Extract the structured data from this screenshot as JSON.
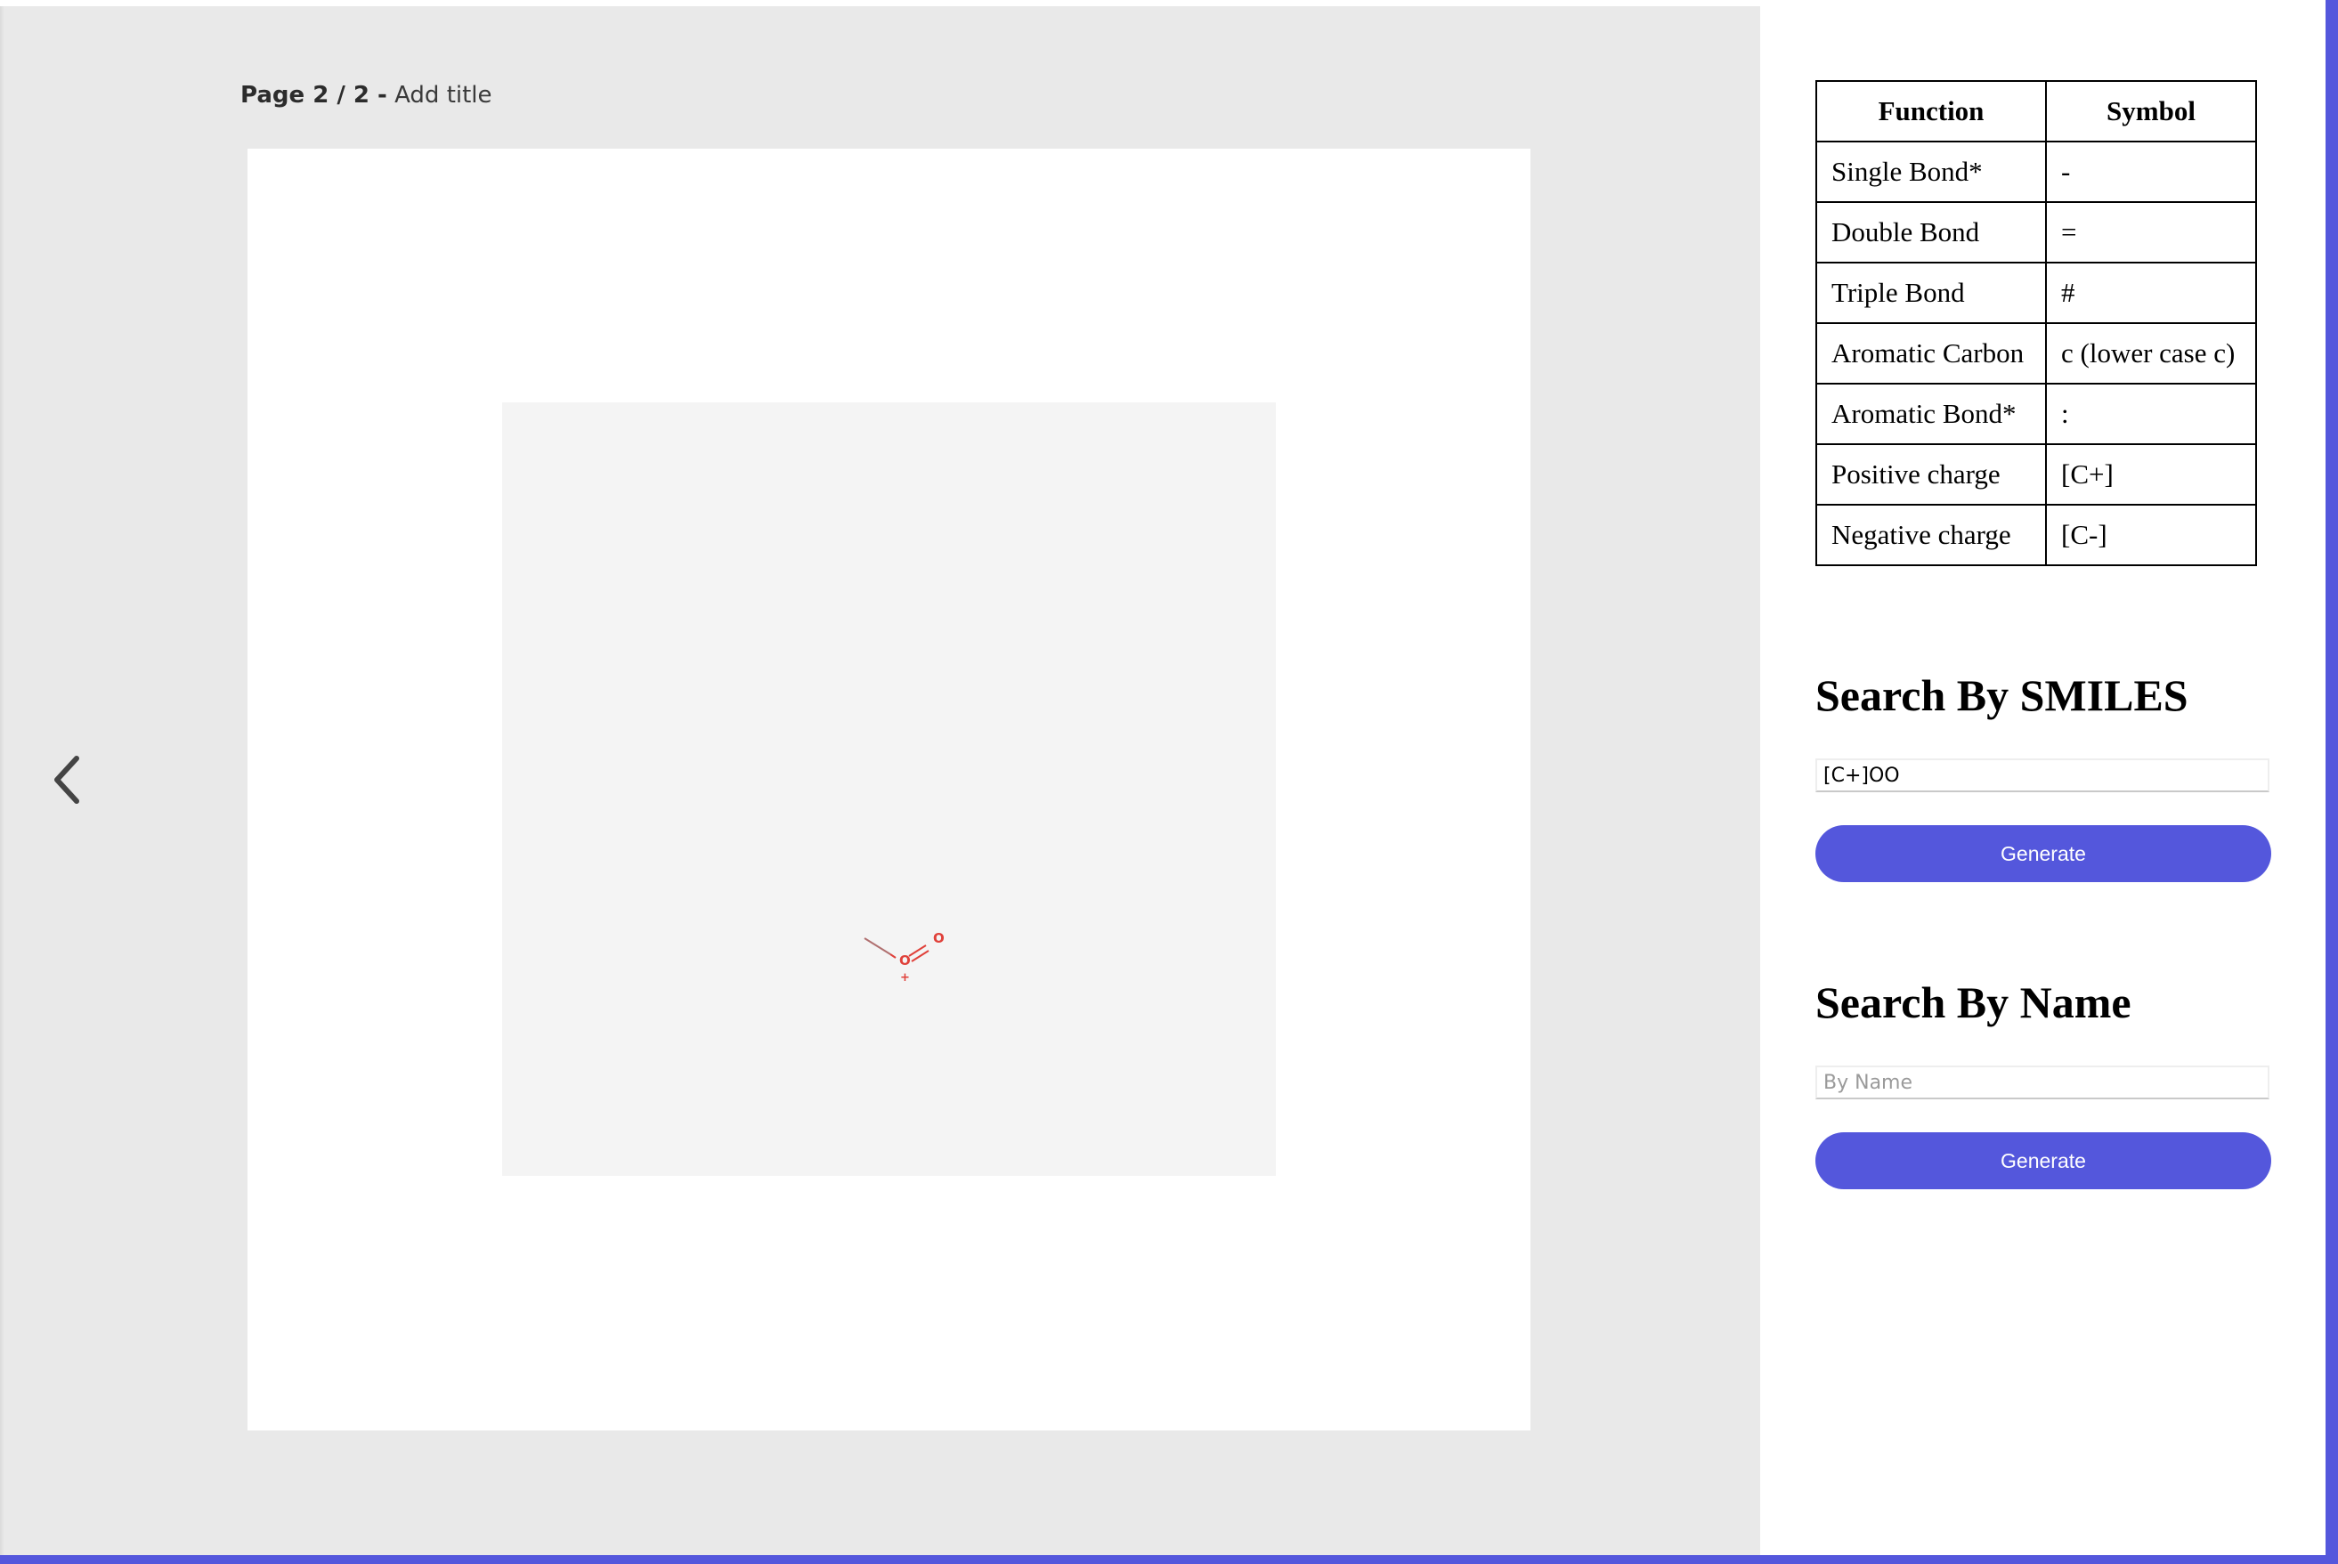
{
  "viewer": {
    "page_label_bold": "Page 2 / 2 -",
    "page_label_title": "Add title",
    "prev_icon": "chevron-left-icon"
  },
  "molecule": {
    "atoms": [
      "O",
      "+",
      "O"
    ],
    "color": "#e0413a",
    "bond_color": "#d06060"
  },
  "reference_table": {
    "headers": [
      "Function",
      "Symbol"
    ],
    "rows": [
      [
        "Single Bond*",
        "-"
      ],
      [
        "Double Bond",
        "="
      ],
      [
        "Triple Bond",
        "#"
      ],
      [
        "Aromatic Carbon",
        "c (lower case c)"
      ],
      [
        "Aromatic Bond*",
        ":"
      ],
      [
        "Positive charge",
        "[C+]"
      ],
      [
        "Negative charge",
        "[C-]"
      ]
    ]
  },
  "smiles_search": {
    "title": "Search By SMILES",
    "value": "[C+]OO",
    "button_label": "Generate"
  },
  "name_search": {
    "title": "Search By Name",
    "value": "",
    "placeholder": "By Name",
    "button_label": "Generate"
  },
  "colors": {
    "accent": "#5457dc",
    "canvas_bg": "#e9e9e9",
    "molecule_panel_bg": "#f4f4f4"
  }
}
